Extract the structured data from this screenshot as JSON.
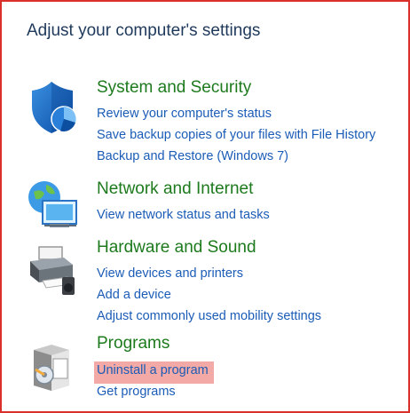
{
  "page": {
    "title": "Adjust your computer's settings",
    "highlight_color": "#f3a9a5",
    "border_color": "#d9302c"
  },
  "categories": [
    {
      "title": "System and Security",
      "icon": "shield-icon",
      "links": [
        "Review your computer's status",
        "Save backup copies of your files with File History",
        "Backup and Restore (Windows 7)"
      ]
    },
    {
      "title": "Network and Internet",
      "icon": "network-globe-icon",
      "links": [
        "View network status and tasks"
      ]
    },
    {
      "title": "Hardware and Sound",
      "icon": "printer-icon",
      "links": [
        "View devices and printers",
        "Add a device",
        "Adjust commonly used mobility settings"
      ]
    },
    {
      "title": "Programs",
      "icon": "programs-box-icon",
      "links": [
        "Uninstall a program",
        "Get programs"
      ],
      "highlighted_link": "Uninstall a program"
    }
  ]
}
